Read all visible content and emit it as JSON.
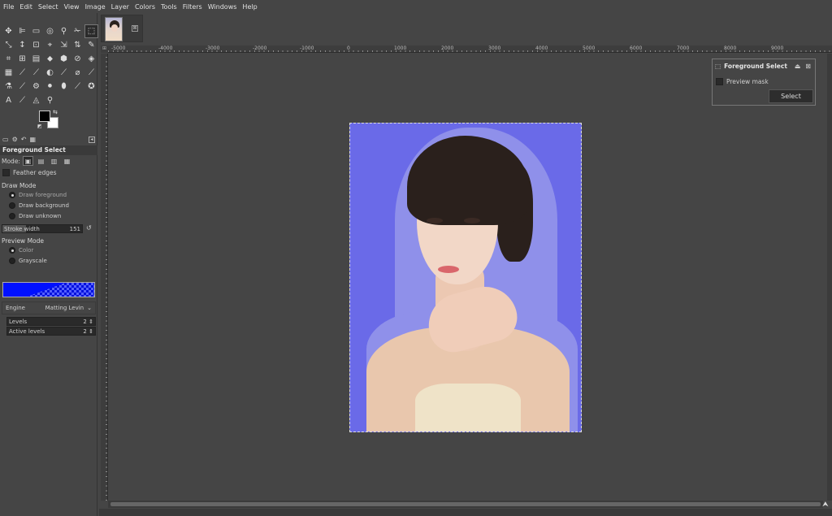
{
  "menubar": [
    "File",
    "Edit",
    "Select",
    "View",
    "Image",
    "Layer",
    "Colors",
    "Tools",
    "Filters",
    "Windows",
    "Help"
  ],
  "toolbox": {
    "tool_icons": [
      "✥",
      "⊫",
      "▭",
      "◎",
      "⚲",
      "✁",
      "⬚",
      "⤡",
      "↕",
      "⊡",
      "⌖",
      "⇲",
      "⇅",
      "✎",
      "⌗",
      "⊞",
      "▤",
      "⬥",
      "⬢",
      "⊘",
      "◈",
      "▦",
      "⟋",
      "⟋",
      "◐",
      "⟋",
      "⌀",
      "⟋",
      "⚗",
      "⟋",
      "⚙",
      "⚫",
      "⬮",
      "⟋",
      "✪",
      "A",
      "⟋",
      "◬",
      "⚲"
    ],
    "active_tool_index": 6,
    "swap_icon": "⇆",
    "reset_icon": "◩",
    "dock_tab_icons": [
      "▭",
      "⚙",
      "↶",
      "▦"
    ],
    "dock_menu_icon": "◂"
  },
  "tool_options": {
    "title": "Foreground Select",
    "mode_label": "Mode:",
    "mode_icons": [
      "▣",
      "▤",
      "▥",
      "▦"
    ],
    "feather_edges": "Feather edges",
    "draw_mode_label": "Draw Mode",
    "draw_modes": [
      "Draw foreground",
      "Draw background",
      "Draw unknown"
    ],
    "stroke_width_label": "Stroke width",
    "stroke_width_value": "151",
    "stroke_width_fill": 0.3,
    "reset_icon": "↺",
    "preview_mode_label": "Preview Mode",
    "preview_modes": [
      "Color",
      "Grayscale"
    ],
    "engine_label": "Engine",
    "engine_value": "Matting Levin",
    "engine_chevron": "⌄",
    "levels_label": "Levels",
    "levels_value": "2",
    "active_levels_label": "Active levels",
    "active_levels_value": "2",
    "spin_icon": "⇕"
  },
  "image_tab": {
    "close_icon": "⊠"
  },
  "ruler": {
    "corner_icon": "⊞",
    "labels": [
      "-5000",
      "-4000",
      "-3000",
      "-2000",
      "-1000",
      "0",
      "1000",
      "2000",
      "3000",
      "4000",
      "5000",
      "6000",
      "7000",
      "8000",
      "9000"
    ]
  },
  "fs_dialog": {
    "title": "Foreground Select",
    "icon": "⬚",
    "pin_icon": "⏏",
    "close_icon": "⊠",
    "preview_mask": "Preview mask",
    "select_button": "Select"
  },
  "navigate_icon": "⮝",
  "colors": {
    "canvas_bg": "#454545",
    "image_blue": "#6a6ae8",
    "foreground_overlay": "#8f90ea",
    "preview_color": "#0010ff"
  }
}
